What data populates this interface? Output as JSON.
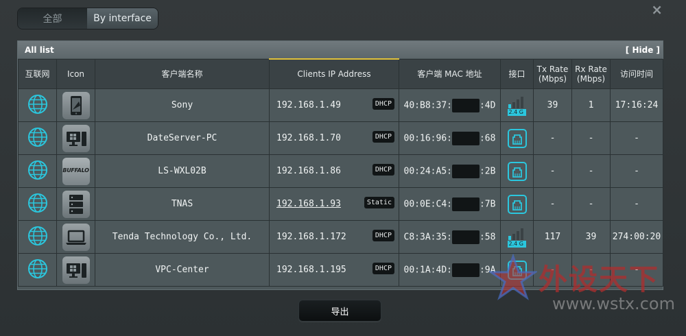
{
  "tabs": {
    "all": "全部",
    "by_interface": "By interface"
  },
  "close_glyph": "×",
  "panel": {
    "title": "All list",
    "hide_label": "[ Hide ]"
  },
  "columns": [
    "互联网",
    "Icon",
    "客户端名称",
    "Clients IP Address",
    "客户端 MAC 地址",
    "接口",
    "Tx Rate (Mbps)",
    "Rx Rate (Mbps)",
    "访问时间"
  ],
  "clients": [
    {
      "internet_icon": "globe-icon",
      "device_icon": "phone-icon",
      "name": "Sony",
      "ip": "192.168.1.49",
      "ip_type": "DHCP",
      "mac_prefix": "40:B8:37:",
      "mac_suffix": ":4D",
      "interface": "wifi-2.4g-icon",
      "interface_label": "2.4 G",
      "tx": "39",
      "rx": "1",
      "time": "17:16:24"
    },
    {
      "internet_icon": "globe-icon",
      "device_icon": "windows-pc-icon",
      "name": "DateServer-PC",
      "ip": "192.168.1.70",
      "ip_type": "DHCP",
      "mac_prefix": "00:16:96:",
      "mac_suffix": ":68",
      "interface": "ethernet-icon",
      "tx": "-",
      "rx": "-",
      "time": "-"
    },
    {
      "internet_icon": "globe-icon",
      "device_icon": "buffalo-logo",
      "device_logo_text": "BUFFALO",
      "name": "LS-WXL02B",
      "ip": "192.168.1.86",
      "ip_type": "DHCP",
      "mac_prefix": "00:24:A5:",
      "mac_suffix": ":2B",
      "interface": "ethernet-icon",
      "tx": "-",
      "rx": "-",
      "time": "-"
    },
    {
      "internet_icon": "globe-icon",
      "device_icon": "nas-server-icon",
      "name": "TNAS",
      "ip": "192.168.1.93",
      "ip_type": "Static",
      "mac_prefix": "00:0E:C4:",
      "mac_suffix": ":7B",
      "interface": "ethernet-icon",
      "tx": "-",
      "rx": "-",
      "time": "-"
    },
    {
      "internet_icon": "globe-icon",
      "device_icon": "laptop-icon",
      "name": "Tenda Technology Co., Ltd.",
      "ip": "192.168.1.172",
      "ip_type": "DHCP",
      "mac_prefix": "C8:3A:35:",
      "mac_suffix": ":58",
      "interface": "wifi-2.4g-icon",
      "interface_label": "2.4 G",
      "tx": "117",
      "rx": "39",
      "time": "274:00:20"
    },
    {
      "internet_icon": "globe-icon",
      "device_icon": "windows-pc-icon",
      "name": "VPC-Center",
      "ip": "192.168.1.195",
      "ip_type": "DHCP",
      "mac_prefix": "00:1A:4D:",
      "mac_suffix": ":9A",
      "interface": "ethernet-icon",
      "tx": "-",
      "rx": "-",
      "time": "-"
    }
  ],
  "export_label": "导出",
  "watermark": {
    "brand": "外设天下",
    "url": "www.wstx.com"
  },
  "colors": {
    "accent_yellow": "#e0c13a",
    "icon_cyan": "#2bc7de",
    "panel_bg": "#4d585b",
    "header_bg": "#3a4245"
  }
}
